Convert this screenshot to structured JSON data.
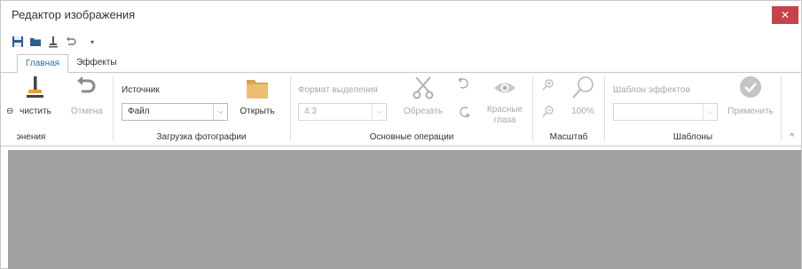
{
  "window": {
    "title": "Редактор изображения",
    "close_glyph": "✕"
  },
  "qat": {
    "items": [
      {
        "icon": "save-icon"
      },
      {
        "icon": "open-folder-icon"
      },
      {
        "icon": "clear-icon"
      },
      {
        "icon": "undo-icon"
      }
    ],
    "more_glyph": "▾"
  },
  "tabs": [
    {
      "label": "Главная",
      "active": true
    },
    {
      "label": "Эффекты",
      "active": false
    }
  ],
  "ribbon": {
    "groups": {
      "editing": {
        "label": "энения",
        "clear_label": "чистить",
        "cancel_label": "Отмена"
      },
      "load": {
        "label": "Загрузка фотографии",
        "source_label": "Источник",
        "source_value": "Файл",
        "open_label": "Открыть"
      },
      "basic": {
        "label": "Основные операции",
        "format_label": "Формат выделения",
        "format_value": "4:3",
        "crop_label": "Обрезать",
        "redeye_label_1": "Красные",
        "redeye_label_2": "глаза"
      },
      "zoom": {
        "label": "Масштаб",
        "zoom_value": "100%"
      },
      "templates": {
        "label": "Шаблоны",
        "template_label": "Шаблон эффектов",
        "template_value": "",
        "apply_label": "Применить"
      }
    },
    "collapse_glyph": "^"
  },
  "colors": {
    "accent": "#2a70c2",
    "close": "#c7424a",
    "canvas": "#a0a0a0",
    "folder": "#e8b86b"
  }
}
